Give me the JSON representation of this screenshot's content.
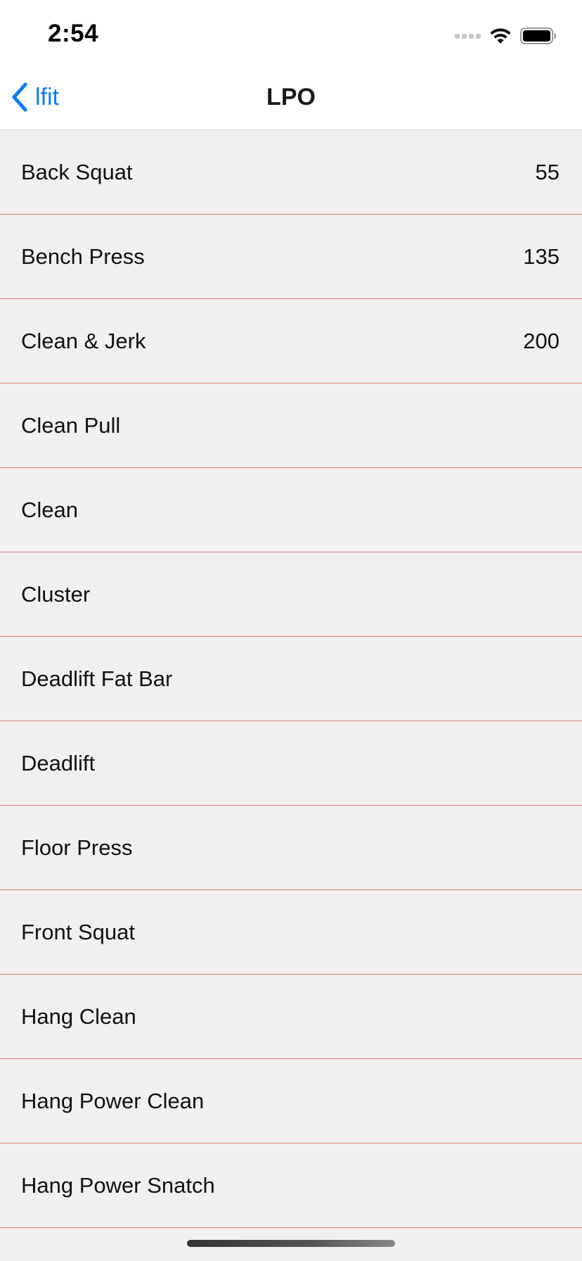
{
  "status_bar": {
    "time": "2:54"
  },
  "nav": {
    "back_label": "lfit",
    "title": "LPO"
  },
  "colors": {
    "accent": "#0a7aff",
    "separator": "#e07b7b",
    "list_background": "#f0f0f0"
  },
  "icons": {
    "back": "chevron-left-icon",
    "wifi": "wifi-icon",
    "battery": "battery-icon",
    "signal": "signal-icon"
  },
  "lifts": [
    {
      "name": "Back Squat",
      "value": "55"
    },
    {
      "name": "Bench Press",
      "value": "135"
    },
    {
      "name": "Clean & Jerk",
      "value": "200"
    },
    {
      "name": "Clean Pull",
      "value": ""
    },
    {
      "name": "Clean",
      "value": ""
    },
    {
      "name": "Cluster",
      "value": ""
    },
    {
      "name": "Deadlift Fat Bar",
      "value": ""
    },
    {
      "name": "Deadlift",
      "value": ""
    },
    {
      "name": "Floor Press",
      "value": ""
    },
    {
      "name": "Front Squat",
      "value": ""
    },
    {
      "name": "Hang Clean",
      "value": ""
    },
    {
      "name": "Hang Power Clean",
      "value": ""
    },
    {
      "name": "Hang Power Snatch",
      "value": ""
    }
  ]
}
